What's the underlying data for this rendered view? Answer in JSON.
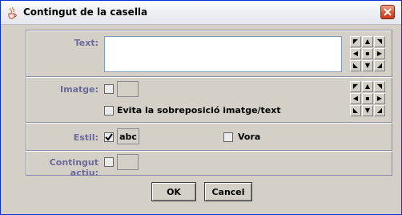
{
  "window": {
    "title": "Contingut de la casella"
  },
  "text_section": {
    "label": "Text:"
  },
  "image_section": {
    "label": "Imatge:",
    "avoid_overlap_label": "Evita la sobreposició imatge/text"
  },
  "style_section": {
    "label": "Estil:",
    "style_value": "abc",
    "border_label": "Vora",
    "style_checked": true,
    "border_checked": false
  },
  "active_section": {
    "label": "Contingut actiu:"
  },
  "buttons": {
    "ok": "OK",
    "cancel": "Cancel"
  },
  "alignment_icons": [
    "arrow-up-left-icon",
    "arrow-up-icon",
    "arrow-up-right-icon",
    "arrow-left-icon",
    "center-dot-icon",
    "arrow-right-icon",
    "arrow-down-left-icon",
    "arrow-down-icon",
    "arrow-down-right-icon"
  ],
  "alignment_glyphs": [
    "◤",
    "▲",
    "◥",
    "◀",
    "▪",
    "▶",
    "◣",
    "▼",
    "◢"
  ],
  "colors": {
    "label": "#6b6b9b",
    "titlebar_border": "#0831d9",
    "dialog_bg": "#d4d0c8"
  }
}
